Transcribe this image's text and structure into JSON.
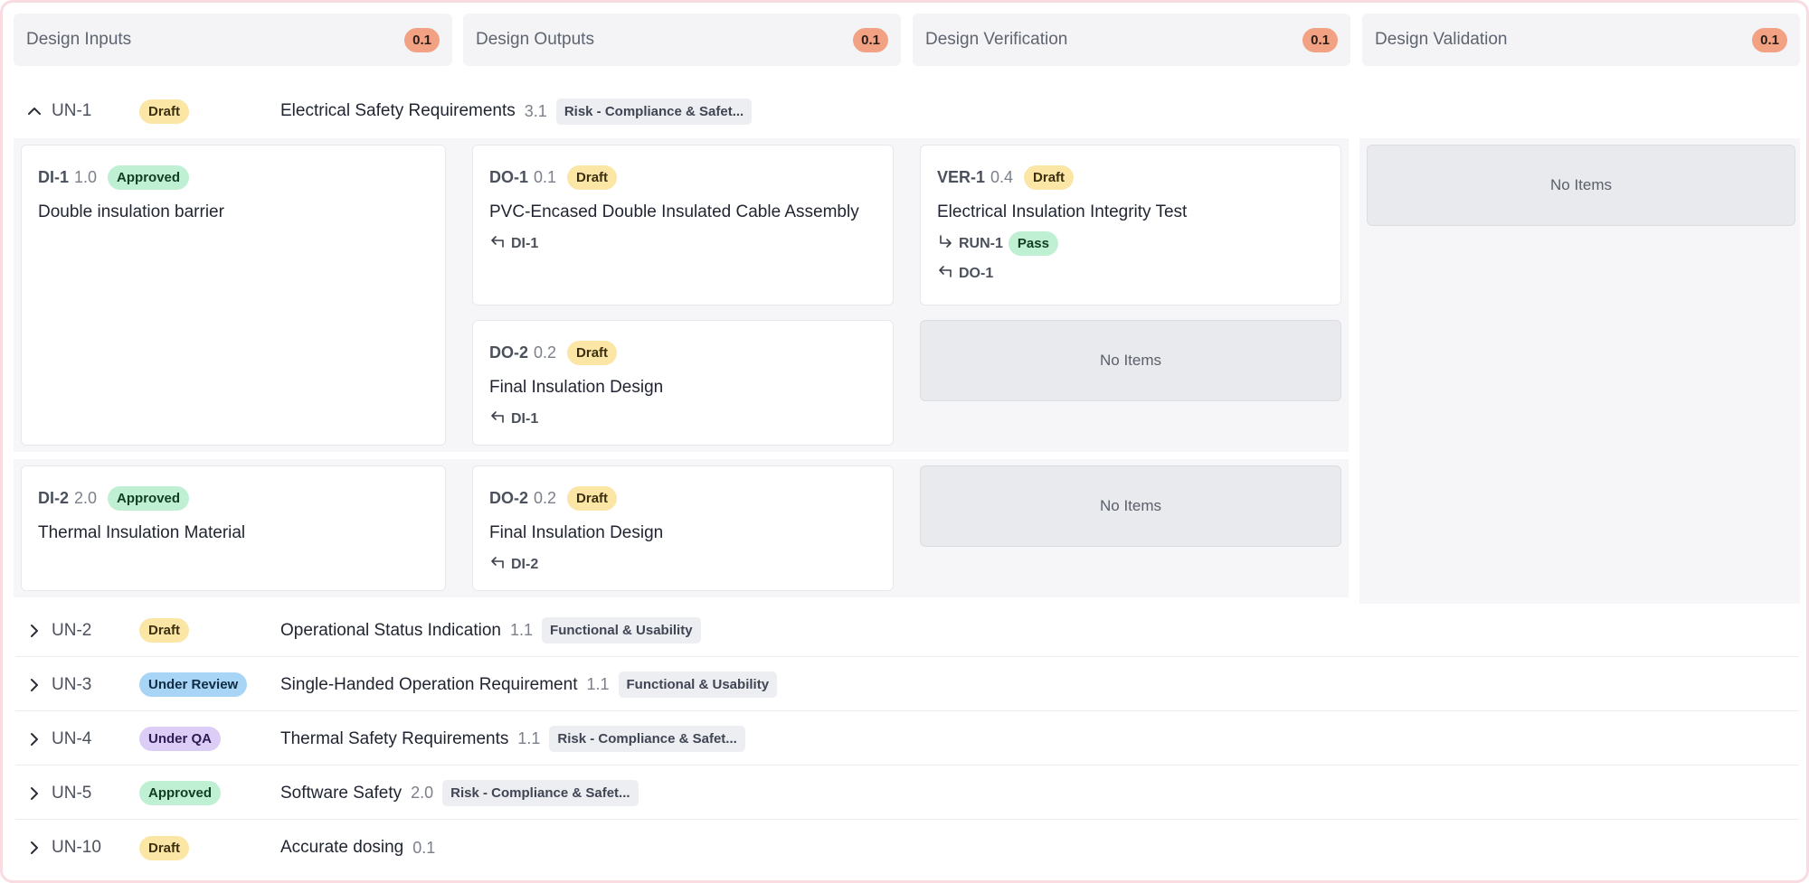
{
  "columns": [
    {
      "label": "Design Inputs",
      "count": "0.1"
    },
    {
      "label": "Design Outputs",
      "count": "0.1"
    },
    {
      "label": "Design Verification",
      "count": "0.1"
    },
    {
      "label": "Design Validation",
      "count": "0.1"
    }
  ],
  "un1": {
    "id": "UN-1",
    "status": "Draft",
    "title": "Electrical Safety Requirements",
    "version": "3.1",
    "tag": "Risk - Compliance & Safet...",
    "di1": {
      "id": "DI-1",
      "version": "1.0",
      "status": "Approved",
      "title": "Double insulation barrier"
    },
    "di2": {
      "id": "DI-2",
      "version": "2.0",
      "status": "Approved",
      "title": "Thermal Insulation Material"
    },
    "do1": {
      "id": "DO-1",
      "version": "0.1",
      "status": "Draft",
      "title": "PVC-Encased Double Insulated Cable Assembly",
      "ref": "DI-1"
    },
    "do2a": {
      "id": "DO-2",
      "version": "0.2",
      "status": "Draft",
      "title": "Final Insulation Design",
      "ref": "DI-1"
    },
    "do2b": {
      "id": "DO-2",
      "version": "0.2",
      "status": "Draft",
      "title": "Final Insulation Design",
      "ref": "DI-2"
    },
    "ver1": {
      "id": "VER-1",
      "version": "0.4",
      "status": "Draft",
      "title": "Electrical Insulation Integrity Test",
      "run": "RUN-1",
      "run_status": "Pass",
      "ref": "DO-1"
    },
    "empty_label": "No Items"
  },
  "rows": [
    {
      "id": "UN-2",
      "status": "Draft",
      "title": "Operational Status Indication",
      "version": "1.1",
      "tag": "Functional & Usability"
    },
    {
      "id": "UN-3",
      "status": "Under Review",
      "title": "Single-Handed Operation Requirement",
      "version": "1.1",
      "tag": "Functional & Usability"
    },
    {
      "id": "UN-4",
      "status": "Under QA",
      "title": "Thermal Safety Requirements",
      "version": "1.1",
      "tag": "Risk - Compliance & Safet..."
    },
    {
      "id": "UN-5",
      "status": "Approved",
      "title": "Software Safety",
      "version": "2.0",
      "tag": "Risk - Compliance & Safet..."
    },
    {
      "id": "UN-10",
      "status": "Draft",
      "title": "Accurate dosing",
      "version": "0.1",
      "tag": ""
    }
  ],
  "colors": {
    "draft": "#fbe6a6",
    "approved": "#bff0d3",
    "under_review": "#a8d4f5",
    "under_qa": "#dccdf7",
    "count_badge": "#f2a183",
    "frame_border": "#f9dbe2"
  }
}
